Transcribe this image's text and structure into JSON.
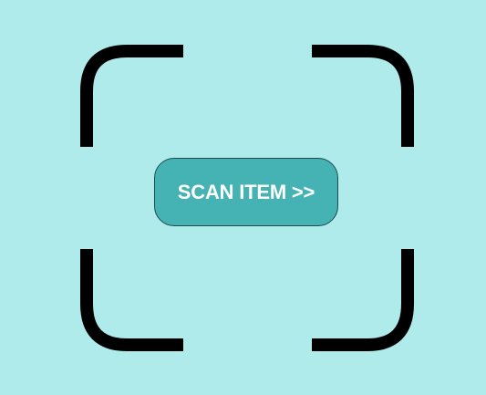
{
  "colors": {
    "background": "#aeebea",
    "frame": "#000000",
    "button_fill": "#45b3b4",
    "button_border": "#1f4a4d",
    "button_text": "#ffffff"
  },
  "scanner": {
    "corner_icons": [
      "top-left-corner-icon",
      "top-right-corner-icon",
      "bottom-left-corner-icon",
      "bottom-right-corner-icon"
    ],
    "button_label": "SCAN ITEM >>"
  }
}
